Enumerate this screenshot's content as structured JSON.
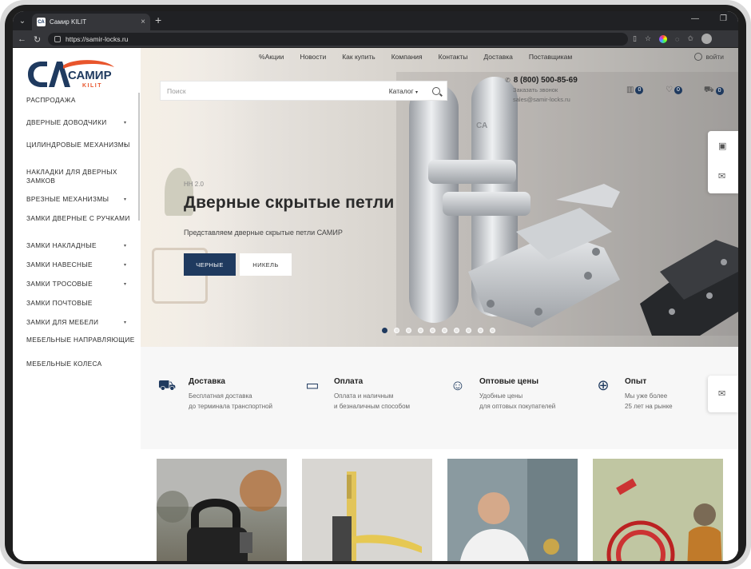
{
  "browser": {
    "tab_title": "Самир KILIT",
    "tab_favicon": "СА",
    "url": "https://samir-locks.ru"
  },
  "logo": {
    "text_main": "САМИР",
    "text_sub": "KILIT"
  },
  "sidebar": {
    "items": [
      {
        "label": "РАСПРОДАЖА",
        "has_children": false
      },
      {
        "label": "ДВЕРНЫЕ ДОВОДЧИКИ",
        "has_children": true
      },
      {
        "label": "ЦИЛИНДРОВЫЕ МЕХАНИЗМЫ",
        "has_children": true
      },
      {
        "label": "НАКЛАДКИ ДЛЯ ДВЕРНЫХ ЗАМКОВ",
        "has_children": false
      },
      {
        "label": "ВРЕЗНЫЕ МЕХАНИЗМЫ",
        "has_children": true
      },
      {
        "label": "ЗАМКИ ДВЕРНЫЕ С РУЧКАМИ",
        "has_children": false
      },
      {
        "label": "ЗАМКИ НАКЛАДНЫЕ",
        "has_children": true
      },
      {
        "label": "ЗАМКИ НАВЕСНЫЕ",
        "has_children": true
      },
      {
        "label": "ЗАМКИ ТРОСОВЫЕ",
        "has_children": true
      },
      {
        "label": "ЗАМКИ ПОЧТОВЫЕ",
        "has_children": false
      },
      {
        "label": "ЗАМКИ ДЛЯ МЕБЕЛИ",
        "has_children": true
      },
      {
        "label": "МЕБЕЛЬНЫЕ НАПРАВЛЯЮЩИЕ",
        "has_children": false
      },
      {
        "label": "МЕБЕЛЬНЫЕ КОЛЕСА",
        "has_children": false
      }
    ]
  },
  "topnav": {
    "items": [
      "Акции",
      "Новости",
      "Как купить",
      "Компания",
      "Контакты",
      "Доставка",
      "Поставщикам"
    ],
    "login": "войти"
  },
  "search": {
    "placeholder": "Поиск",
    "catalog": "Каталог"
  },
  "contacts": {
    "phone": "8 (800) 500-85-69",
    "callback": "Заказать звонок",
    "email": "sales@samir-locks.ru"
  },
  "header_counters": {
    "compare": "0",
    "favorites": "0",
    "cart": "0"
  },
  "hero": {
    "subtitle": "НН 2.0",
    "title": "Дверные скрытые петли",
    "description": "Представляем дверные скрытые петли САМИР",
    "btn_primary": "ЧЕРНЫЕ",
    "btn_secondary": "НИКЕЛЬ",
    "slides_total": 10,
    "slide_active": 1
  },
  "features": [
    {
      "icon": "truck-icon",
      "title": "Доставка",
      "line1": "Бесплатная доставка",
      "line2": "до терминала транспортной"
    },
    {
      "icon": "card-icon",
      "title": "Оплата",
      "line1": "Оплата и наличным",
      "line2": "и безналичным способом"
    },
    {
      "icon": "smile-icon",
      "title": "Оптовые цены",
      "line1": "Удобные цены",
      "line2": "для оптовых покупателей"
    },
    {
      "icon": "lifebuoy-icon",
      "title": "Опыт",
      "line1": "Мы уже более",
      "line2": "25 лет на рынке"
    }
  ],
  "colors": {
    "brand": "#1f3a5f",
    "accent": "#e8552c"
  }
}
